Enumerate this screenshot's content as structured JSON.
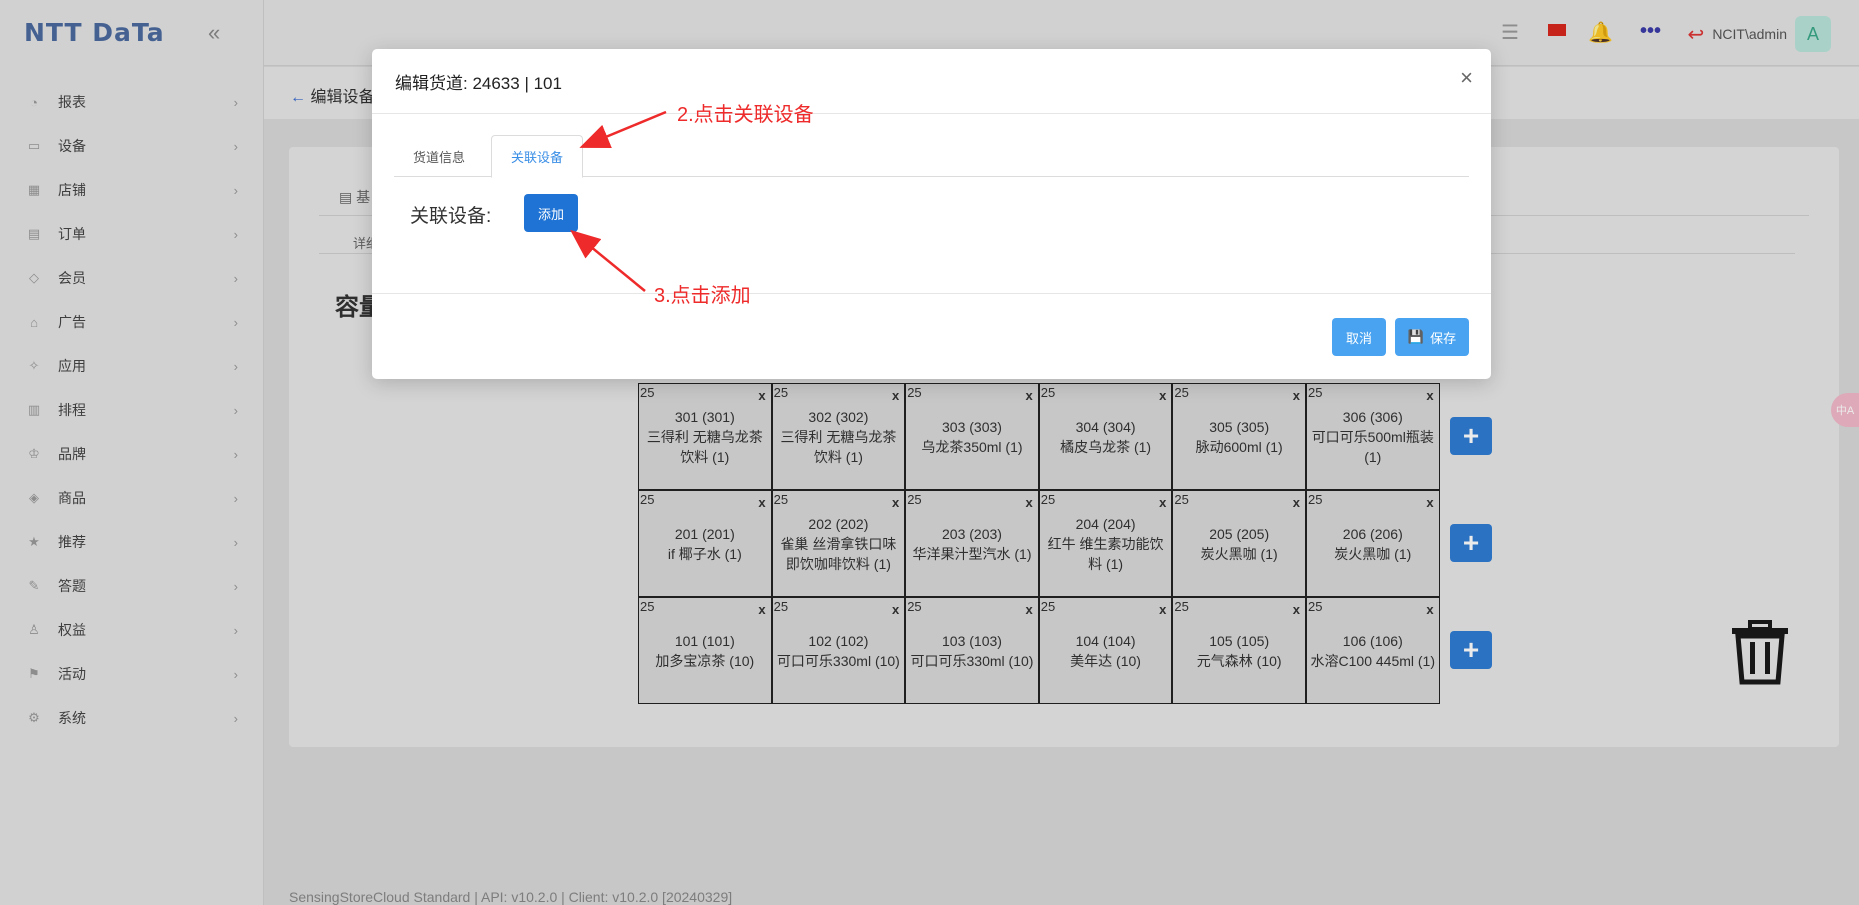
{
  "brand": {
    "logo": "NTT DaTa"
  },
  "sidebar": {
    "items": [
      {
        "label": "报表",
        "icon": "dashboard-icon",
        "glyph": "◔"
      },
      {
        "label": "设备",
        "icon": "device-icon",
        "glyph": "▭"
      },
      {
        "label": "店铺",
        "icon": "store-icon",
        "glyph": "▦"
      },
      {
        "label": "订单",
        "icon": "order-icon",
        "glyph": "▤"
      },
      {
        "label": "会员",
        "icon": "member-icon",
        "glyph": "◇"
      },
      {
        "label": "广告",
        "icon": "ad-icon",
        "glyph": "⌂"
      },
      {
        "label": "应用",
        "icon": "app-icon",
        "glyph": "✧"
      },
      {
        "label": "排程",
        "icon": "schedule-icon",
        "glyph": "▥"
      },
      {
        "label": "品牌",
        "icon": "brand-icon",
        "glyph": "♔"
      },
      {
        "label": "商品",
        "icon": "product-icon",
        "glyph": "◈"
      },
      {
        "label": "推荐",
        "icon": "star-icon",
        "glyph": "★"
      },
      {
        "label": "答题",
        "icon": "quiz-icon",
        "glyph": "✎"
      },
      {
        "label": "权益",
        "icon": "benefit-icon",
        "glyph": "♙"
      },
      {
        "label": "活动",
        "icon": "activity-icon",
        "glyph": "⚑"
      },
      {
        "label": "系统",
        "icon": "settings-icon",
        "glyph": "⚙"
      }
    ]
  },
  "topbar": {
    "user": "NCIT\\admin",
    "avatar": "A"
  },
  "page": {
    "back_label": "编辑设备",
    "card_tab": "基",
    "card_sub": "详细",
    "capacity_title": "容量",
    "footer": "SensingStoreCloud Standard | API: v10.2.0 | Client: v10.2.0 [20240329]"
  },
  "modal": {
    "title": "编辑货道: 24633 | 101",
    "tabs": [
      "货道信息",
      "关联设备"
    ],
    "related_label": "关联设备:",
    "add_button": "添加",
    "cancel_button": "取消",
    "save_button": "保存"
  },
  "annotations": {
    "step2": "2.点击关联设备",
    "step3": "3.点击添加"
  },
  "shelf": {
    "rows": [
      [
        {
          "cap": "25",
          "code": "301 (301)",
          "product": "三得利 无糖乌龙茶饮料 (1)"
        },
        {
          "cap": "25",
          "code": "302 (302)",
          "product": "三得利 无糖乌龙茶饮料 (1)"
        },
        {
          "cap": "25",
          "code": "303 (303)",
          "product": "乌龙茶350ml (1)"
        },
        {
          "cap": "25",
          "code": "304 (304)",
          "product": "橘皮乌龙茶 (1)"
        },
        {
          "cap": "25",
          "code": "305 (305)",
          "product": "脉动600ml (1)"
        },
        {
          "cap": "25",
          "code": "306 (306)",
          "product": "可口可乐500ml瓶装 (1)"
        }
      ],
      [
        {
          "cap": "25",
          "code": "201 (201)",
          "product": "if 椰子水 (1)"
        },
        {
          "cap": "25",
          "code": "202 (202)",
          "product": "雀巢 丝滑拿铁口味即饮咖啡饮料 (1)"
        },
        {
          "cap": "25",
          "code": "203 (203)",
          "product": "华洋果汁型汽水 (1)"
        },
        {
          "cap": "25",
          "code": "204 (204)",
          "product": "红牛 维生素功能饮料 (1)"
        },
        {
          "cap": "25",
          "code": "205 (205)",
          "product": "炭火黑咖 (1)"
        },
        {
          "cap": "25",
          "code": "206 (206)",
          "product": "炭火黑咖 (1)"
        }
      ],
      [
        {
          "cap": "25",
          "code": "101 (101)",
          "product": "加多宝凉茶 (10)"
        },
        {
          "cap": "25",
          "code": "102 (102)",
          "product": "可口可乐330ml (10)"
        },
        {
          "cap": "25",
          "code": "103 (103)",
          "product": "可口可乐330ml (10)"
        },
        {
          "cap": "25",
          "code": "104 (104)",
          "product": "美年达 (10)"
        },
        {
          "cap": "25",
          "code": "105 (105)",
          "product": "元气森林 (10)"
        },
        {
          "cap": "25",
          "code": "106 (106)",
          "product": "水溶C100 445ml (1)"
        }
      ]
    ],
    "remove_label": "x",
    "add_label": "+"
  },
  "lang_badge": "中A"
}
